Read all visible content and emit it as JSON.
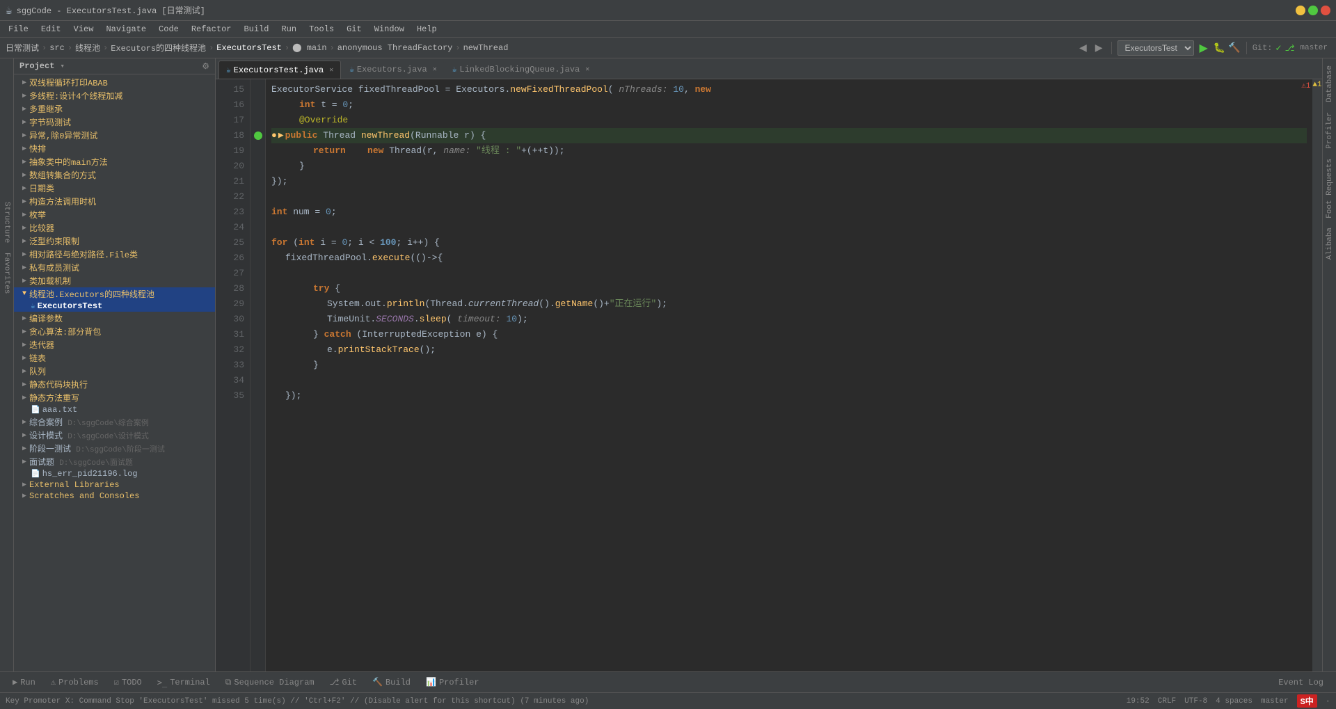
{
  "window": {
    "title": "sggCode - ExecutorsTest.java [日常测试]"
  },
  "menu": {
    "items": [
      "File",
      "Edit",
      "View",
      "Navigate",
      "Code",
      "Refactor",
      "Build",
      "Run",
      "Tools",
      "Git",
      "Window",
      "Help"
    ]
  },
  "breadcrumb": {
    "items": [
      "日常测试",
      "src",
      "线程池",
      "Executors的四种线程池",
      "ExecutorsTest",
      "main",
      "anonymous ThreadFactory",
      "newThread"
    ]
  },
  "toolbar": {
    "config": "ExecutorsTest",
    "git_label": "Git:"
  },
  "tabs": [
    {
      "label": "ExecutorsTest.java",
      "active": true,
      "icon": "☕"
    },
    {
      "label": "Executors.java",
      "active": false,
      "icon": "☕"
    },
    {
      "label": "LinkedBlockingQueue.java",
      "active": false,
      "icon": "☕"
    }
  ],
  "project_tree": [
    {
      "indent": 0,
      "label": "双线程循环打印ABAB",
      "type": "folder",
      "expanded": false
    },
    {
      "indent": 0,
      "label": "多线程:设计4个线程加减",
      "type": "folder",
      "expanded": false
    },
    {
      "indent": 0,
      "label": "多重继承",
      "type": "folder",
      "expanded": false
    },
    {
      "indent": 0,
      "label": "字节码测试",
      "type": "folder",
      "expanded": false
    },
    {
      "indent": 0,
      "label": "异常,除0异常测试",
      "type": "folder",
      "expanded": false
    },
    {
      "indent": 0,
      "label": "快排",
      "type": "folder",
      "expanded": false
    },
    {
      "indent": 0,
      "label": "抽象类中的main方法",
      "type": "folder",
      "expanded": false
    },
    {
      "indent": 0,
      "label": "数组转集合的方式",
      "type": "folder",
      "expanded": false
    },
    {
      "indent": 0,
      "label": "日期类",
      "type": "folder",
      "expanded": false
    },
    {
      "indent": 0,
      "label": "构造方法调用时机",
      "type": "folder",
      "expanded": false
    },
    {
      "indent": 0,
      "label": "枚举",
      "type": "folder",
      "expanded": false
    },
    {
      "indent": 0,
      "label": "比较器",
      "type": "folder",
      "expanded": false
    },
    {
      "indent": 0,
      "label": "泛型约束限制",
      "type": "folder",
      "expanded": false
    },
    {
      "indent": 0,
      "label": "相对路径与绝对路径.File类",
      "type": "folder",
      "expanded": false
    },
    {
      "indent": 0,
      "label": "私有成员测试",
      "type": "folder",
      "expanded": false
    },
    {
      "indent": 0,
      "label": "类加载机制",
      "type": "folder",
      "expanded": false
    },
    {
      "indent": 0,
      "label": "线程池.Executors的四种线程池",
      "type": "folder",
      "expanded": true,
      "active": true
    },
    {
      "indent": 1,
      "label": "ExecutorsTest",
      "type": "java",
      "active": true
    },
    {
      "indent": 0,
      "label": "编译参数",
      "type": "folder",
      "expanded": false
    },
    {
      "indent": 0,
      "label": "贪心算法:部分背包",
      "type": "folder",
      "expanded": false
    },
    {
      "indent": 0,
      "label": "迭代器",
      "type": "folder",
      "expanded": false
    },
    {
      "indent": 0,
      "label": "链表",
      "type": "folder",
      "expanded": false
    },
    {
      "indent": 0,
      "label": "队列",
      "type": "folder",
      "expanded": false
    },
    {
      "indent": 0,
      "label": "静态代码块执行",
      "type": "folder",
      "expanded": false
    },
    {
      "indent": 0,
      "label": "静态方法重写",
      "type": "folder",
      "expanded": false
    },
    {
      "indent": 1,
      "label": "aaa.txt",
      "type": "text"
    },
    {
      "indent": 0,
      "label": "综合案例 D:\\sggCode\\综合案例",
      "type": "root"
    },
    {
      "indent": 0,
      "label": "设计模式 D:\\sggCode\\设计模式",
      "type": "root"
    },
    {
      "indent": 0,
      "label": "阶段一测试 D:\\sggCode\\阶段一测试",
      "type": "root"
    },
    {
      "indent": 0,
      "label": "面试题 D:\\sggCode\\面试题",
      "type": "root"
    },
    {
      "indent": 1,
      "label": "hs_err_pid21196.log",
      "type": "log"
    },
    {
      "indent": 0,
      "label": "External Libraries",
      "type": "folder"
    },
    {
      "indent": 0,
      "label": "Scratches and Consoles",
      "type": "folder"
    }
  ],
  "code": {
    "lines": [
      {
        "num": 15,
        "content": "ExecutorService fixedThreadPool = Executors.newFixedThreadPool( nThreads: 10, new",
        "has_bp": false,
        "has_run": false
      },
      {
        "num": 16,
        "content": "    int t = 0;",
        "has_bp": false,
        "has_run": false
      },
      {
        "num": 17,
        "content": "    @Override",
        "has_bp": false,
        "has_run": false
      },
      {
        "num": 18,
        "content": "    public Thread newThread(Runnable r) {",
        "has_bp": true,
        "has_run": true
      },
      {
        "num": 19,
        "content": "        return    new Thread(r, name: \"线程 : \"+(++t));",
        "has_bp": false,
        "has_run": false
      },
      {
        "num": 20,
        "content": "    }",
        "has_bp": false,
        "has_run": false
      },
      {
        "num": 21,
        "content": "});",
        "has_bp": false,
        "has_run": false
      },
      {
        "num": 22,
        "content": "",
        "has_bp": false,
        "has_run": false
      },
      {
        "num": 23,
        "content": "int num = 0;",
        "has_bp": false,
        "has_run": false
      },
      {
        "num": 24,
        "content": "",
        "has_bp": false,
        "has_run": false
      },
      {
        "num": 25,
        "content": "for (int i = 0; i < 100; i++) {",
        "has_bp": false,
        "has_run": false
      },
      {
        "num": 26,
        "content": "    fixedThreadPool.execute(()->{ ",
        "has_bp": false,
        "has_run": false
      },
      {
        "num": 27,
        "content": "",
        "has_bp": false,
        "has_run": false
      },
      {
        "num": 28,
        "content": "        try {",
        "has_bp": false,
        "has_run": false
      },
      {
        "num": 29,
        "content": "            System.out.println(Thread.currentThread().getName()+\"正在运行\");",
        "has_bp": false,
        "has_run": false
      },
      {
        "num": 30,
        "content": "            TimeUnit.SECONDS.sleep( timeout: 10);",
        "has_bp": false,
        "has_run": false
      },
      {
        "num": 31,
        "content": "        } catch (InterruptedException e) {",
        "has_bp": false,
        "has_run": false
      },
      {
        "num": 32,
        "content": "            e.printStackTrace();",
        "has_bp": false,
        "has_run": false
      },
      {
        "num": 33,
        "content": "        }",
        "has_bp": false,
        "has_run": false
      },
      {
        "num": 34,
        "content": "",
        "has_bp": false,
        "has_run": false
      },
      {
        "num": 35,
        "content": "    });",
        "has_bp": false,
        "has_run": false
      }
    ]
  },
  "bottom_tabs": [
    {
      "label": "Run",
      "icon": "▶"
    },
    {
      "label": "Problems",
      "icon": "⚠"
    },
    {
      "label": "TODO",
      "icon": "☑"
    },
    {
      "label": "Terminal",
      "icon": ">_"
    },
    {
      "label": "Sequence Diagram",
      "icon": "⧉"
    },
    {
      "label": "Git",
      "icon": "⎇"
    },
    {
      "label": "Build",
      "icon": "🔨"
    },
    {
      "label": "Profiler",
      "icon": "📊"
    }
  ],
  "status": {
    "message": "Key Promoter X: Command Stop 'ExecutorsTest' missed 5 time(s) // 'Ctrl+F2' // (Disable alert for this shortcut) (7 minutes ago)",
    "time": "19:52",
    "encoding": "CRLF",
    "charset": "UTF-8",
    "indent": "4 spaces",
    "line_col": "master"
  },
  "right_panels": [
    "Database",
    "Profiler",
    "Foot Requests",
    "Alibaba"
  ]
}
